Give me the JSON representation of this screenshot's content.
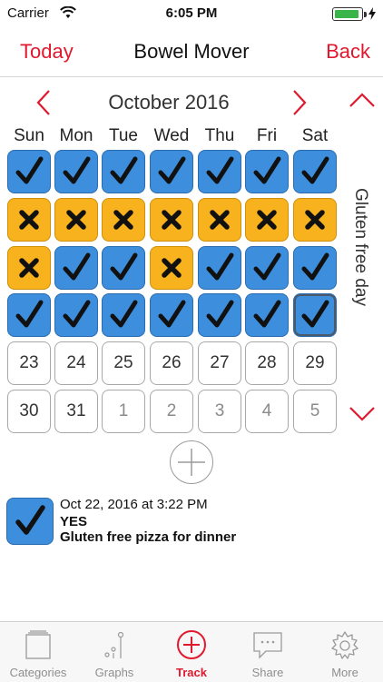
{
  "status_bar": {
    "carrier": "Carrier",
    "time": "6:05 PM"
  },
  "nav": {
    "left_label": "Today",
    "title": "Bowel Mover",
    "right_label": "Back"
  },
  "calendar": {
    "month_label": "October 2016",
    "weekdays": [
      "Sun",
      "Mon",
      "Tue",
      "Wed",
      "Thu",
      "Fri",
      "Sat"
    ],
    "weeks": [
      [
        "yes",
        "yes",
        "yes",
        "yes",
        "yes",
        "yes",
        "yes"
      ],
      [
        "no",
        "no",
        "no",
        "no",
        "no",
        "no",
        "no"
      ],
      [
        "no",
        "yes",
        "yes",
        "no",
        "yes",
        "yes",
        "yes"
      ],
      [
        "yes",
        "yes",
        "yes",
        "yes",
        "yes",
        "yes",
        "yes-selected"
      ],
      [
        "23",
        "24",
        "25",
        "26",
        "27",
        "28",
        "29"
      ],
      [
        "30",
        "31",
        "1",
        "2",
        "3",
        "4",
        "5"
      ]
    ],
    "dimmed_days": [
      "1",
      "2",
      "3",
      "4",
      "5"
    ],
    "category_label": "Gluten free day"
  },
  "entry": {
    "datetime": "Oct 22, 2016 at 3:22 PM",
    "answer": "YES",
    "note": "Gluten free pizza for dinner"
  },
  "tabs": [
    {
      "label": "Categories",
      "icon": "categories-icon",
      "active": false
    },
    {
      "label": "Graphs",
      "icon": "graphs-icon",
      "active": false
    },
    {
      "label": "Track",
      "icon": "track-plus-icon",
      "active": true
    },
    {
      "label": "Share",
      "icon": "share-icon",
      "active": false
    },
    {
      "label": "More",
      "icon": "gear-icon",
      "active": false
    }
  ],
  "colors": {
    "accent": "#e0192e",
    "yes": "#3d8fdd",
    "no": "#f7b21d"
  }
}
